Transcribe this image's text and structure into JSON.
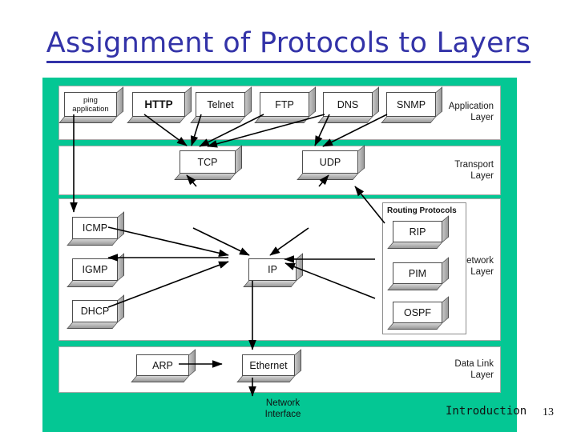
{
  "slide": {
    "title": "Assignment of Protocols to Layers",
    "title_color": "#3333a8",
    "panel_color": "#04c794"
  },
  "layers": {
    "application": {
      "label": "Application\nLayer",
      "boxes": [
        {
          "name": "ping-application",
          "label": "ping\napplication"
        },
        {
          "name": "http",
          "label": "HTTP"
        },
        {
          "name": "telnet",
          "label": "Telnet"
        },
        {
          "name": "ftp",
          "label": "FTP"
        },
        {
          "name": "dns",
          "label": "DNS"
        },
        {
          "name": "snmp",
          "label": "SNMP"
        }
      ]
    },
    "transport": {
      "label": "Transport\nLayer",
      "boxes": [
        {
          "name": "tcp",
          "label": "TCP"
        },
        {
          "name": "udp",
          "label": "UDP"
        }
      ]
    },
    "network": {
      "label": "Network\nLayer",
      "boxes": [
        {
          "name": "icmp",
          "label": "ICMP"
        },
        {
          "name": "igmp",
          "label": "IGMP"
        },
        {
          "name": "dhcp",
          "label": "DHCP"
        },
        {
          "name": "ip",
          "label": "IP"
        }
      ],
      "routing_group": {
        "title": "Routing Protocols",
        "boxes": [
          {
            "name": "rip",
            "label": "RIP"
          },
          {
            "name": "pim",
            "label": "PIM"
          },
          {
            "name": "ospf",
            "label": "OSPF"
          }
        ]
      }
    },
    "datalink": {
      "label": "Data Link\nLayer",
      "boxes": [
        {
          "name": "arp",
          "label": "ARP"
        },
        {
          "name": "ethernet",
          "label": "Ethernet"
        }
      ]
    }
  },
  "network_interface_label": "Network\nInterface",
  "footer": {
    "subject": "Introduction",
    "page": "13"
  }
}
